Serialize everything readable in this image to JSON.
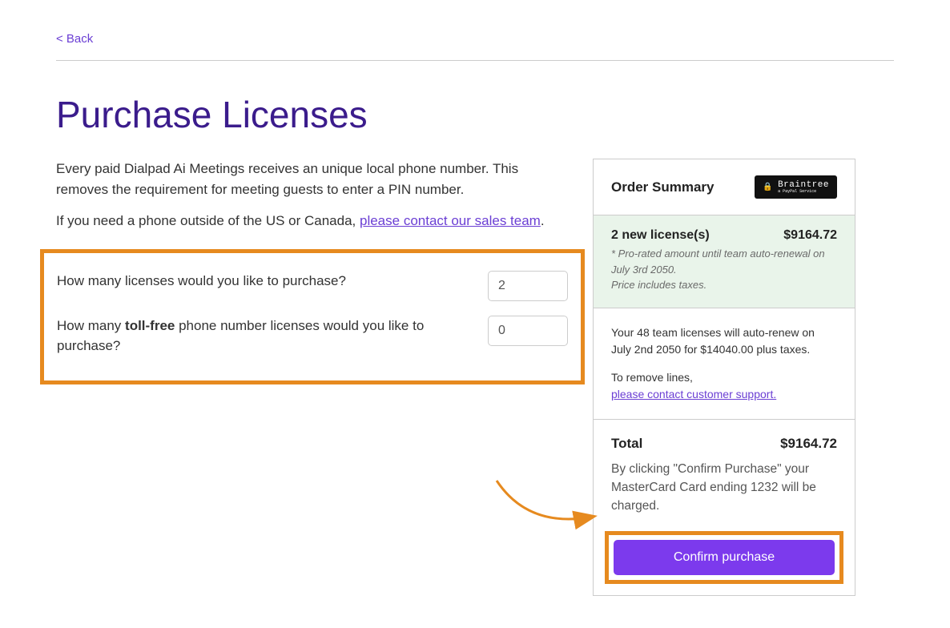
{
  "back_label": "<  Back",
  "page_title": "Purchase Licenses",
  "intro_line1": "Every paid Dialpad Ai Meetings receives an unique local phone number. This removes the requirement for meeting guests to enter a PIN number.",
  "intro_line2_prefix": "If you need a phone outside of the US or Canada, ",
  "intro_line2_link": "please contact our sales team",
  "intro_line2_suffix": ".",
  "form": {
    "licenses_label": "How many licenses would you like to purchase?",
    "licenses_value": "2",
    "tollfree_prefix": "How many ",
    "tollfree_bold": "toll-free",
    "tollfree_suffix": " phone number licenses would you like to purchase?",
    "tollfree_value": "0"
  },
  "order": {
    "summary_title": "Order Summary",
    "badge_text": "Braintree",
    "badge_subtext": "a PayPal Service",
    "line_item_label": "2 new license(s)",
    "line_item_amount": "$9164.72",
    "line_note1": "* Pro-rated amount until team auto-renewal on July 3rd 2050.",
    "line_note2": "Price includes taxes.",
    "renew_text": "Your 48 team licenses will auto-renew on July 2nd 2050 for $14040.00 plus taxes.",
    "remove_prefix": "To remove lines,",
    "remove_link": "please contact customer support.",
    "total_label": "Total",
    "total_amount": "$9164.72",
    "charge_text": "By clicking \"Confirm Purchase\" your MasterCard Card ending 1232 will be charged.",
    "confirm_label": "Confirm purchase"
  }
}
